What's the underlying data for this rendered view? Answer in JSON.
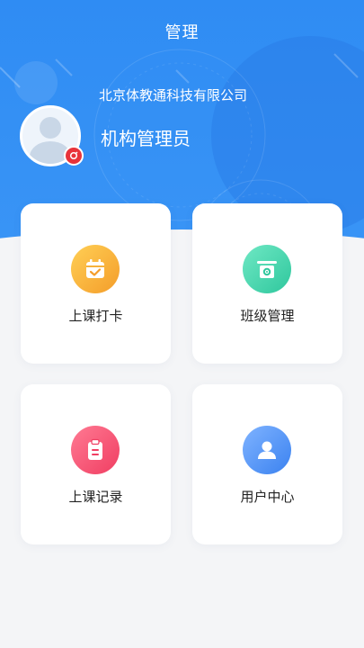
{
  "header": {
    "title": "管理",
    "company": "北京体教通科技有限公司",
    "role": "机构管理员"
  },
  "menu": {
    "items": [
      {
        "label": "上课打卡",
        "icon": "calendar-check-icon"
      },
      {
        "label": "班级管理",
        "icon": "class-board-icon"
      },
      {
        "label": "上课记录",
        "icon": "clipboard-icon"
      },
      {
        "label": "用户中心",
        "icon": "user-icon"
      }
    ]
  },
  "colors": {
    "header_blue": "#2f8cf3",
    "badge_red": "#e8333a",
    "checkin_orange": "#f49d2a",
    "class_green": "#2fc79d",
    "record_red": "#f03e62",
    "user_blue": "#3b82f0"
  }
}
